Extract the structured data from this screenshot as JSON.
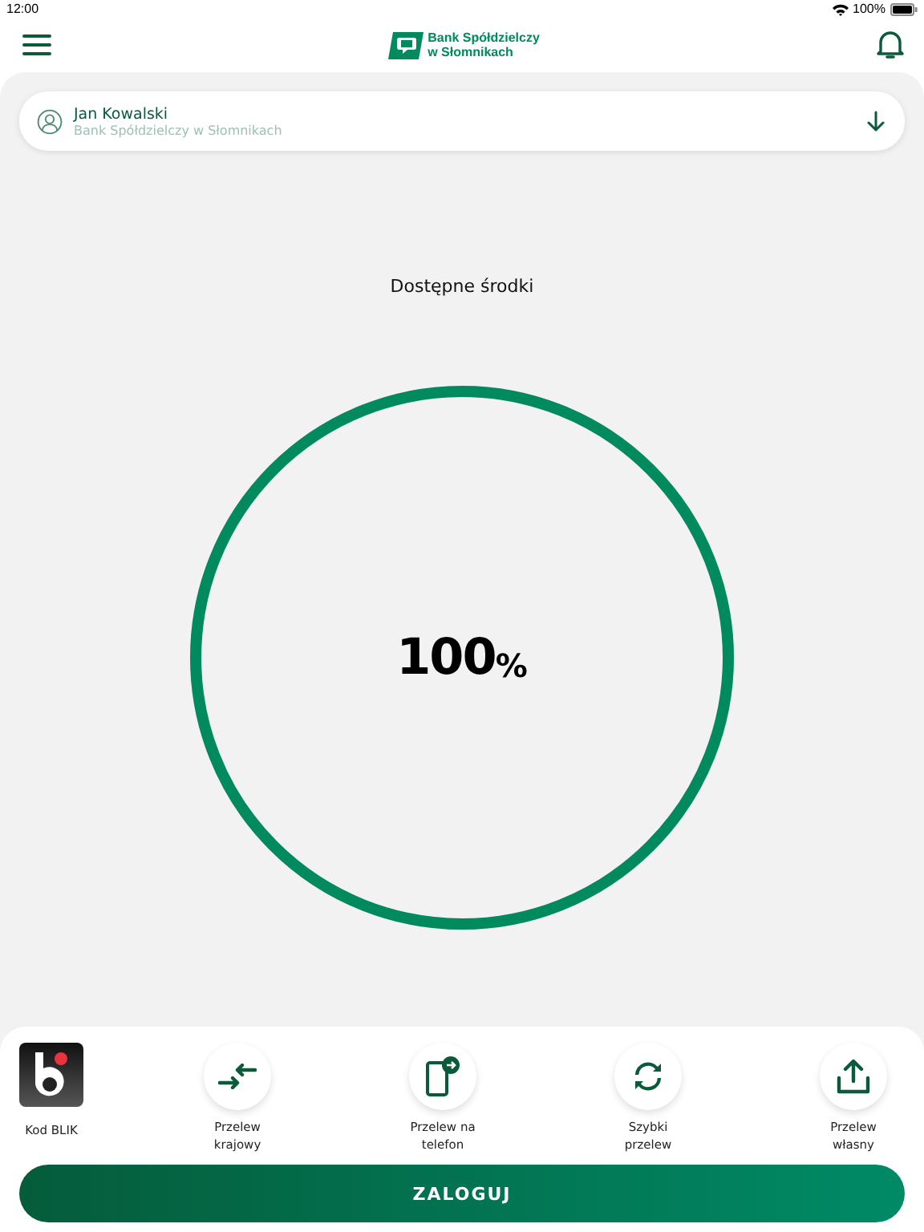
{
  "status_bar": {
    "time": "12:00",
    "battery": "100%"
  },
  "header": {
    "bank_name_line1": "Bank Spółdzielczy",
    "bank_name_line2": "w Słomnikach"
  },
  "account": {
    "name": "Jan Kowalski",
    "bank": "Bank Spółdzielczy w Słomnikach"
  },
  "balance": {
    "label": "Dostępne środki",
    "value": "100",
    "unit": "%",
    "level": 1
  },
  "actions": [
    {
      "kind": "blik",
      "label": "Kod BLIK"
    },
    {
      "kind": "circle",
      "label": "Przelew krajowy"
    },
    {
      "kind": "circle",
      "label": "Przelew na telefon"
    },
    {
      "kind": "circle",
      "label": "Szybki przelew"
    },
    {
      "kind": "circle",
      "label": "Przelew własny"
    }
  ],
  "login_button": "ZALOGUJ"
}
